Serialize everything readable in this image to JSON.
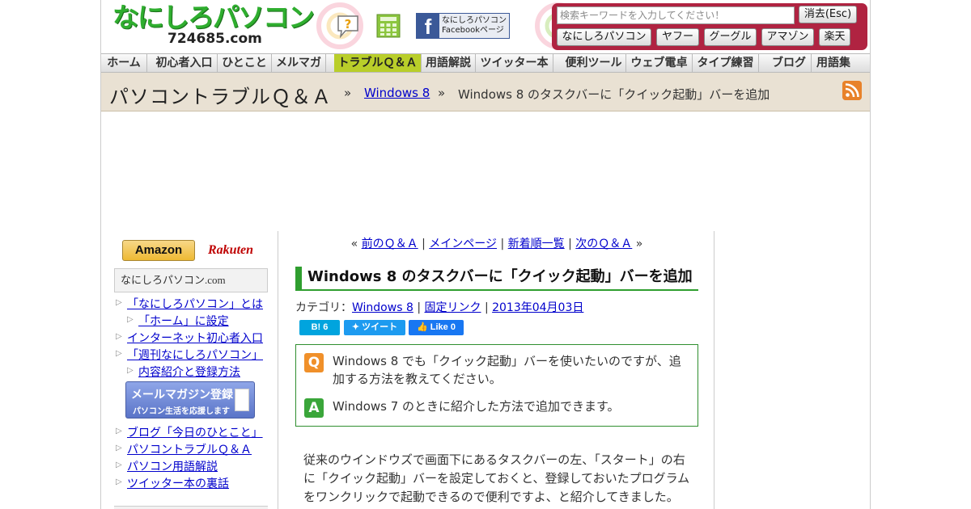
{
  "header": {
    "logo_main": "なにしろパソコン",
    "logo_sub": "724685.com",
    "facebook_line1": "なにしろパソコン",
    "facebook_line2": "Facebookページ",
    "search_placeholder": "検索キーワードを入力してください！",
    "clear_label": "消去(Esc)",
    "search_buttons": [
      "なにしろパソコン",
      "ヤフー",
      "グーグル",
      "アマゾン",
      "楽天"
    ]
  },
  "nav": [
    "ホーム",
    "初心者入口",
    "ひとこと",
    "メルマガ",
    "トラブルＱ＆Ａ",
    "用語解説",
    "ツイッター本",
    "便利ツール",
    "ウェブ電卓",
    "タイプ練習",
    "ブログ",
    "用語集"
  ],
  "titlebar": {
    "title": "パソコントラブルＱ＆Ａ",
    "sep": "»",
    "crumb_link": "Windows 8",
    "crumb_current": "Windows 8 のタスクバーに「クイック起動」バーを追加"
  },
  "sidebar": {
    "amazon": "Amazon",
    "rakuten": "Rakuten",
    "site_name": "なにしろパソコン.com",
    "links": [
      "「なにしろパソコン」とは",
      "「ホーム」に設定",
      "インターネット初心者入口",
      "「週刊なにしろパソコン」",
      "内容紹介と登録方法",
      "ブログ「今日のひとこと」",
      "パソコントラブルＱ＆Ａ",
      "パソコン用語解説",
      "ツイッター本の裏話"
    ],
    "mail_title": "メールマガジン登録",
    "mail_sub": "パソコン生活を応援します"
  },
  "content": {
    "pager_prev": "前のＱ＆Ａ",
    "pager_main": "メインページ",
    "pager_new": "新着順一覧",
    "pager_next": "次のＱ＆Ａ",
    "article_title": "Windows 8 のタスクバーに「クイック起動」バーを追加",
    "meta_category_label": "カテゴリ：",
    "meta_category": "Windows 8",
    "meta_permalink": "固定リンク",
    "meta_date": "2013年04月03日",
    "share_hatena": "B! 6",
    "share_tweet": "ツイート",
    "share_like": "Like 0",
    "q_icon": "Q",
    "q_text": "Windows 8 でも「クイック起動」バーを使いたいのですが、追加する方法を教えてください。",
    "a_icon": "A",
    "a_text": "Windows 7 のときに紹介した方法で追加できます。",
    "body": "従来のウインドウズで画面下にあるタスクバーの左、「スタート」の右に「クイック起動」バーを設定しておくと、登録しておいたプログラムをワンクリックで起動できるので便利ですよ、と紹介してきました。"
  },
  "colors": {
    "accent_green": "#2f9e2f",
    "search_bar": "#b02341",
    "nav_active": "#b9ce2a",
    "link": "#0000cc"
  }
}
